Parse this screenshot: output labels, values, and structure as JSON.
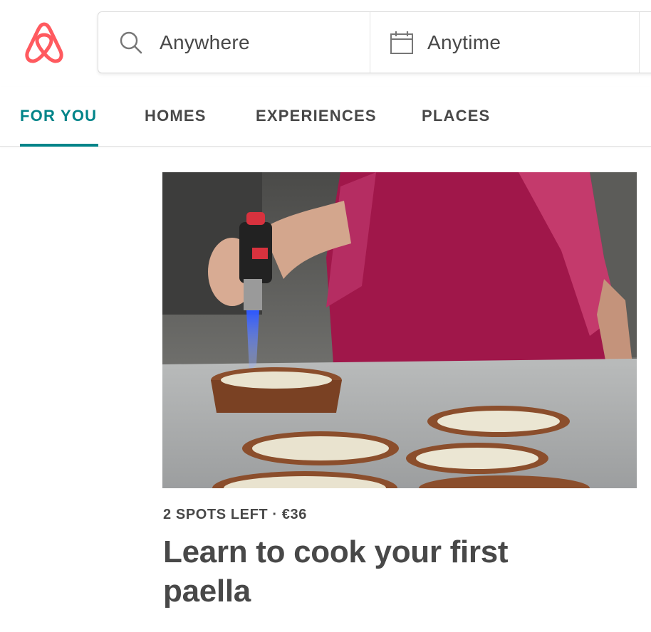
{
  "brand": {
    "logo_icon": "airbnb-belo-icon",
    "color": "#FF5A5F"
  },
  "search": {
    "where": {
      "icon": "search-icon",
      "value": "Anywhere"
    },
    "when": {
      "icon": "calendar-icon",
      "value": "Anytime"
    }
  },
  "tabs": [
    {
      "label": "FOR YOU",
      "active": true
    },
    {
      "label": "HOMES",
      "active": false
    },
    {
      "label": "EXPERIENCES",
      "active": false
    },
    {
      "label": "PLACES",
      "active": false
    }
  ],
  "accent_color": "#008489",
  "card": {
    "meta": "2 SPOTS LEFT · €36",
    "title": "Learn to cook your first paella",
    "image_icon": "experience-photo"
  }
}
